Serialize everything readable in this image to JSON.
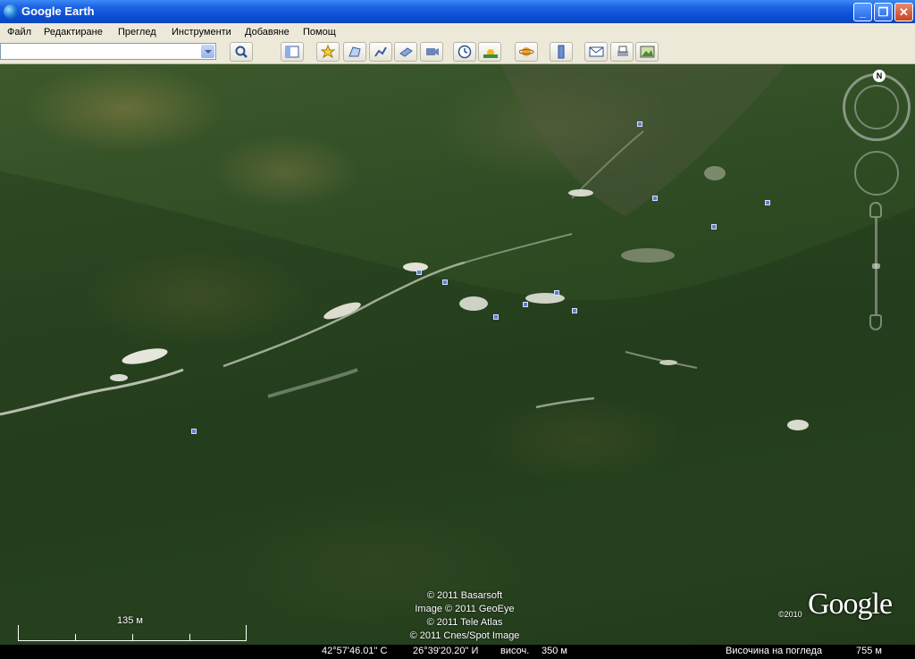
{
  "window": {
    "title": "Google Earth"
  },
  "menu": [
    "Файл",
    "Редактиране",
    "Преглед",
    "Инструменти",
    "Добавяне",
    "Помощ"
  ],
  "search": {
    "value": ""
  },
  "toolbar_icons": [
    "search-icon",
    "sidebar-icon",
    "placemark-icon",
    "polygon-icon",
    "path-icon",
    "overlay-icon",
    "record-tour-icon",
    "clock-icon",
    "sun-icon",
    "planet-icon",
    "ruler-icon",
    "email-icon",
    "print-icon",
    "save-image-icon"
  ],
  "map": {
    "attribution": [
      "© 2011 Basarsoft",
      "Image © 2011 GeoEye",
      "© 2011 Tele Atlas",
      "© 2011 Cnes/Spot Image"
    ],
    "logo": "Google",
    "logo_year": "©2010",
    "scale_label": "135 м",
    "compass_north": "N"
  },
  "status": {
    "latitude": "42°57'46.01\" С",
    "longitude": "26°39'20.20\" И",
    "elevation_label": "височ.",
    "elevation_value": "350 м",
    "eye_alt_label": "Височина на погледа",
    "eye_alt_value": "755 м"
  },
  "colors": {
    "titlebar": "#0a4fd6",
    "menubar": "#ece9d8",
    "terrain": "#2f4c24"
  }
}
